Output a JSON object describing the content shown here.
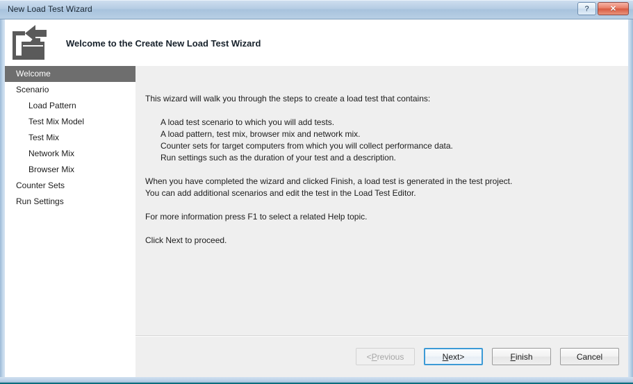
{
  "window": {
    "title": "New Load Test Wizard",
    "help_button_label": "?",
    "close_button_label": "✕"
  },
  "header": {
    "title": "Welcome to the Create New Load Test Wizard",
    "icon": "import-folder-icon"
  },
  "sidebar": {
    "items": [
      {
        "label": "Welcome",
        "level": 1,
        "selected": true
      },
      {
        "label": "Scenario",
        "level": 1,
        "selected": false
      },
      {
        "label": "Load Pattern",
        "level": 2,
        "selected": false
      },
      {
        "label": "Test Mix Model",
        "level": 2,
        "selected": false
      },
      {
        "label": "Test Mix",
        "level": 2,
        "selected": false
      },
      {
        "label": "Network Mix",
        "level": 2,
        "selected": false
      },
      {
        "label": "Browser Mix",
        "level": 2,
        "selected": false
      },
      {
        "label": "Counter Sets",
        "level": 1,
        "selected": false
      },
      {
        "label": "Run Settings",
        "level": 1,
        "selected": false
      }
    ]
  },
  "content": {
    "intro": "This wizard will walk you through the steps to create a load test that contains:",
    "bullets": [
      "A load test scenario to which you will add tests.",
      "A load pattern, test mix, browser mix and network mix.",
      "Counter sets for target computers from which you will collect performance data.",
      "Run settings such as the duration of your test and a description."
    ],
    "para2_line1": "When you have completed the wizard and clicked Finish, a load test is generated in the test project.",
    "para2_line2": "You can add additional scenarios and edit the test in the Load Test Editor.",
    "para3": "For more information press F1 to select a related Help topic.",
    "para4": "Click Next to proceed."
  },
  "footer": {
    "buttons": [
      {
        "name": "previous",
        "prefix": "< ",
        "mnemonic": "P",
        "rest": "revious",
        "suffix": "",
        "state": "disabled"
      },
      {
        "name": "next",
        "prefix": "",
        "mnemonic": "N",
        "rest": "ext",
        "suffix": " >",
        "state": "default"
      },
      {
        "name": "finish",
        "prefix": "",
        "mnemonic": "F",
        "rest": "inish",
        "suffix": "",
        "state": "normal"
      },
      {
        "name": "cancel",
        "prefix": "",
        "mnemonic": "",
        "rest": "Cancel",
        "suffix": "",
        "state": "normal"
      }
    ]
  },
  "colors": {
    "title_bar": "#b6cde4",
    "frame": "#bcd3e8",
    "selection": "#6e6e6e",
    "content_bg": "#efefef",
    "default_button_border": "#3c9ad6",
    "close_button": "#d85b41",
    "icon": "#5a5a5a"
  }
}
